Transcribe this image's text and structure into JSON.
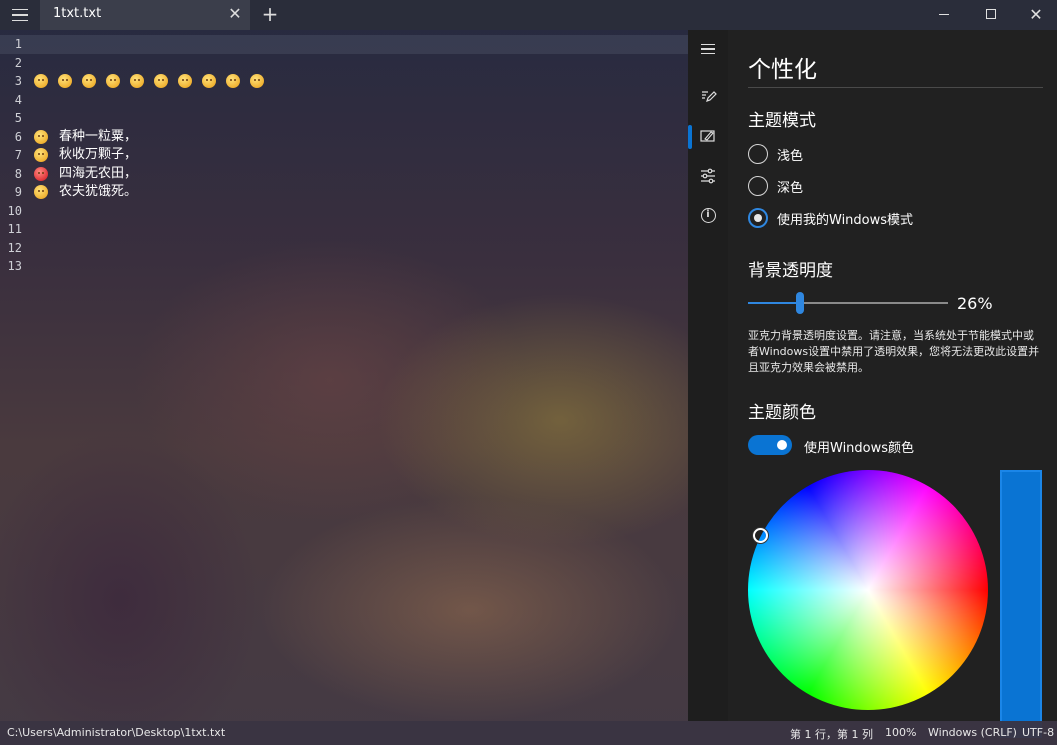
{
  "titlebar": {
    "tab_title": "1txt.txt",
    "tab_close_glyph": "✕",
    "add_tab_glyph": "+",
    "close_glyph": "✕"
  },
  "editor": {
    "line_numbers": [
      "1",
      "2",
      "3",
      "4",
      "5",
      "6",
      "7",
      "8",
      "9",
      "10",
      "11",
      "12",
      "13"
    ],
    "emoji_line_count": 10,
    "poem": [
      {
        "text": "春种一粒粟，",
        "emoji": "grinning-face-icon"
      },
      {
        "text": "秋收万颗子，",
        "emoji": "worried-face-icon"
      },
      {
        "text": "四海无农田，",
        "emoji": "angry-face-icon"
      },
      {
        "text": "农夫犹饿死。",
        "emoji": "glasses-face-icon"
      }
    ]
  },
  "panel": {
    "rail": [
      "hamburger-icon",
      "pen-icon",
      "personalize-icon",
      "sliders-icon",
      "info-icon"
    ],
    "title": "个性化",
    "theme_mode": {
      "heading": "主题模式",
      "options": [
        "浅色",
        "深色",
        "使用我的Windows模式"
      ],
      "selected_index": 2
    },
    "transparency": {
      "heading": "背景透明度",
      "value_percent": 26,
      "value_label": "26%",
      "description": "亚克力背景透明度设置。请注意，当系统处于节能模式中或者Windows设置中禁用了透明效果，您将无法更改此设置并且亚克力效果会被禁用。"
    },
    "theme_color": {
      "heading": "主题颜色",
      "toggle_label": "使用Windows颜色",
      "toggle_on": true,
      "accent_color": "#0A74D3"
    }
  },
  "statusbar": {
    "path": "C:\\Users\\Administrator\\Desktop\\1txt.txt",
    "position": "第 1 行，第 1 列",
    "zoom": "100%",
    "line_ending": "Windows (CRLF)",
    "encoding": "UTF-8"
  }
}
